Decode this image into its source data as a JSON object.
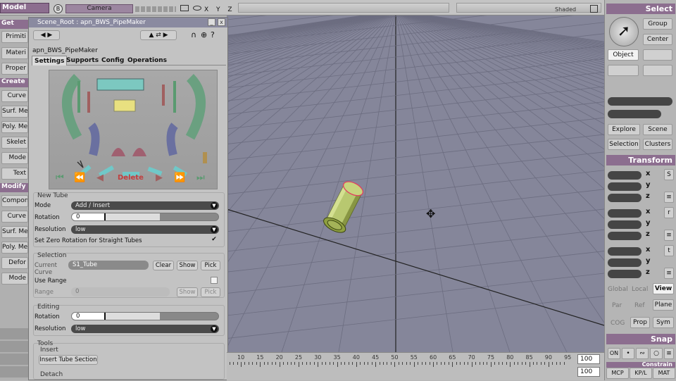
{
  "topbar": {
    "mode": "Model",
    "camera": "Camera",
    "axes": "X Y Z",
    "shaded": "Shaded"
  },
  "left_palette": {
    "get_header": "Get",
    "get_items": [
      "Primiti",
      "Materi",
      "Proper"
    ],
    "create_header": "Create",
    "create_items": [
      "Curve",
      "Surf. Me",
      "Poly. Me",
      "Skelet",
      "Mode",
      "Text"
    ],
    "modify_header": "Modify",
    "modify_items": [
      "Compon",
      "Curve",
      "Surf. Me",
      "Poly. Me",
      "Defor",
      "Mode"
    ]
  },
  "panel": {
    "window_title": "Scene_Root : apn_BWS_PipeMaker",
    "class_name": "apn_BWS_PipeMaker",
    "tabs": [
      "Settings",
      "Supports",
      "Config",
      "Operations"
    ],
    "delete_label": "Delete",
    "new_tube": {
      "header": "New Tube",
      "mode_label": "Mode",
      "mode_value": "Add / Insert",
      "rotation_label": "Rotation",
      "rotation_value": "0",
      "resolution_label": "Resolution",
      "resolution_value": "low",
      "zero_rot_label": "Set Zero Rotation for Straight Tubes",
      "zero_rot_checked": "✔"
    },
    "selection": {
      "header": "Selection",
      "current_curve_label_1": "Current",
      "current_curve_label_2": "Curve",
      "current_curve_value": "S1_Tube",
      "clear": "Clear",
      "show": "Show",
      "pick": "Pick",
      "use_range_label": "Use Range",
      "range_label": "Range",
      "range_value": "0",
      "range_show": "Show",
      "range_pick": "Pick"
    },
    "editing": {
      "header": "Editing",
      "rotation_label": "Rotation",
      "rotation_value": "0",
      "resolution_label": "Resolution",
      "resolution_value": "low"
    },
    "tools": {
      "header": "Tools",
      "insert_header": "Insert",
      "insert_button": "Insert Tube Section",
      "detach_header": "Detach"
    }
  },
  "right_palette": {
    "select_header": "Select",
    "group": "Group",
    "center": "Center",
    "object": "Object",
    "explore": "Explore",
    "scene": "Scene",
    "selection": "Selection",
    "clusters": "Clusters",
    "transform_header": "Transform",
    "axis_x": "x",
    "axis_y": "y",
    "axis_z": "z",
    "scale": "S",
    "rotate": "r",
    "translate": "t",
    "global": "Global",
    "local": "Local",
    "view": "View",
    "par": "Par",
    "ref": "Ref",
    "plane": "Plane",
    "cog": "COG",
    "prop": "Prop",
    "sym": "Sym",
    "snap_header": "Snap",
    "on": "ON",
    "constrain_header": "Constrain",
    "mcp": "MCP",
    "kpl": "KP/L",
    "mat": "MAT"
  },
  "timeline": {
    "ticks": [
      "10",
      "15",
      "20",
      "25",
      "30",
      "35",
      "40",
      "45",
      "50",
      "55",
      "60",
      "65",
      "70",
      "75",
      "80",
      "85",
      "90",
      "95"
    ],
    "end_frame": "100",
    "end_frame_2": "100"
  },
  "colors": {
    "accent": "#8c6e8f",
    "viewport_bg": "#85869a",
    "tube": "#b8c870",
    "select_highlight": "#e04060"
  }
}
